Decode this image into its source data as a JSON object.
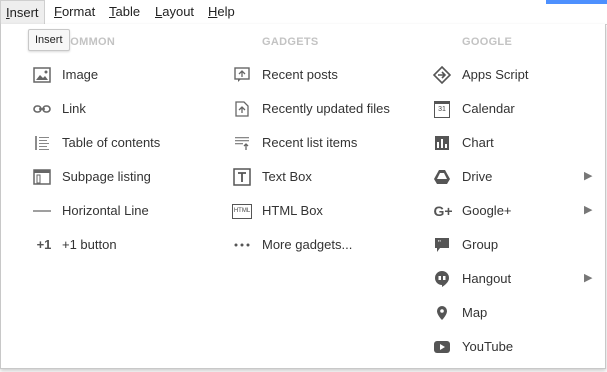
{
  "menubar": {
    "items": [
      {
        "label": "Insert",
        "underline": "I",
        "rest": "nsert"
      },
      {
        "label": "Format",
        "underline": "F",
        "rest": "ormat"
      },
      {
        "label": "Table",
        "underline": "T",
        "rest": "able"
      },
      {
        "label": "Layout",
        "underline": "L",
        "rest": "ayout"
      },
      {
        "label": "Help",
        "underline": "H",
        "rest": "elp"
      }
    ]
  },
  "tooltip": "Insert",
  "columns": {
    "common": {
      "header": "COMMON",
      "items": [
        "Image",
        "Link",
        "Table of contents",
        "Subpage listing",
        "Horizontal Line",
        "+1 button"
      ]
    },
    "gadgets": {
      "header": "GADGETS",
      "items": [
        "Recent posts",
        "Recently updated files",
        "Recent list items",
        "Text Box",
        "HTML Box",
        "More gadgets..."
      ]
    },
    "google": {
      "header": "GOOGLE",
      "items": [
        "Apps Script",
        "Calendar",
        "Chart",
        "Drive",
        "Google+",
        "Group",
        "Hangout",
        "Map",
        "YouTube"
      ]
    }
  },
  "icons": {
    "calendar_text": "31",
    "plus_one_text": "+1",
    "html_text": "HTML",
    "submenu_arrow": "▶"
  },
  "colors": {
    "icon": "#666666",
    "text": "#333333",
    "header": "#c3c3c3",
    "accent": "#4d90fe"
  }
}
